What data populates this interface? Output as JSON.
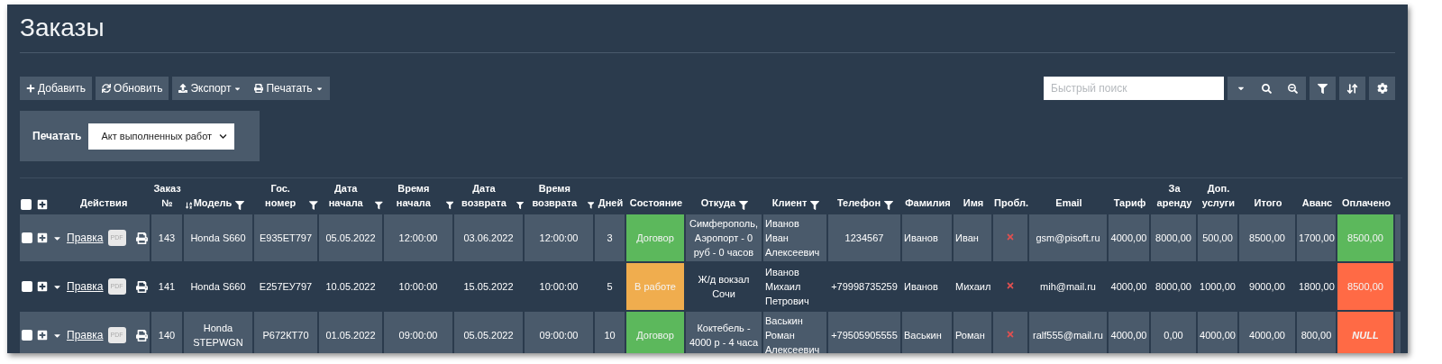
{
  "page": {
    "title": "Заказы"
  },
  "toolbar": {
    "buttons": [
      {
        "label": "Добавить",
        "kind": "add"
      },
      {
        "label": "Обновить",
        "kind": "refresh"
      }
    ],
    "menus": [
      {
        "label": "Экспорт",
        "kind": "export"
      },
      {
        "label": "Печатать",
        "kind": "print"
      }
    ]
  },
  "search": {
    "placeholder": "Быстрый поиск"
  },
  "print_panel": {
    "label": "Печатать",
    "value": "Акт выполненных работ"
  },
  "table": {
    "select_all_checked": false,
    "columns": [
      {
        "label": "Действия",
        "kind": "actions"
      },
      {
        "label": "Заказ №",
        "kind": "text"
      },
      {
        "label": "Модель",
        "kind": "text"
      },
      {
        "label": "Гос. номер",
        "kind": "text"
      },
      {
        "label": "Дата начала",
        "kind": "text"
      },
      {
        "label": "Время начала",
        "kind": "text"
      },
      {
        "label": "Дата возврата",
        "kind": "text"
      },
      {
        "label": "Время возврата",
        "kind": "text"
      },
      {
        "label": "Дней",
        "kind": "text"
      },
      {
        "label": "Состояние",
        "kind": "status"
      },
      {
        "label": "Откуда",
        "kind": "text"
      },
      {
        "label": "Клиент",
        "kind": "left"
      },
      {
        "label": "Телефон",
        "kind": "text"
      },
      {
        "label": "Фамилия",
        "kind": "left"
      },
      {
        "label": "Имя",
        "kind": "left"
      },
      {
        "label": "Пробл.",
        "kind": "problem"
      },
      {
        "label": "Email",
        "kind": "text"
      },
      {
        "label": "Тариф",
        "kind": "text"
      },
      {
        "label": "За аренду",
        "kind": "text"
      },
      {
        "label": "Доп. услуги",
        "kind": "text"
      },
      {
        "label": "Итого",
        "kind": "text"
      },
      {
        "label": "Аванс",
        "kind": "text"
      },
      {
        "label": "Оплачено",
        "kind": "paid"
      }
    ],
    "rows": [
      {
        "checked": false,
        "edit_label": "Правка",
        "pdf_label": "PDF",
        "cells": [
          null,
          "143",
          "Honda S660",
          "Е935ЕТ797",
          "05.05.2022",
          "12:00:00",
          "03.06.2022",
          "12:00:00",
          "3",
          {
            "text": "Договор",
            "color": "#5cb85c"
          },
          "Симферополь, Аэропорт - 0 руб - 0 часов",
          "Иванов Иван Алексеевич",
          "1234567",
          "Иванов",
          "Иван",
          {
            "problem": true
          },
          "gsm@pisoft.ru",
          "4000,00",
          "8000,00",
          "500,00",
          "8500,00",
          "1700,00",
          {
            "text": "8500,00",
            "color": "#5cb85c",
            "kind": "value"
          }
        ]
      },
      {
        "checked": false,
        "edit_label": "Правка",
        "pdf_label": "PDF",
        "cells": [
          null,
          "141",
          "Honda S660",
          "Е257ЕУ797",
          "10.05.2022",
          "10:00:00",
          "15.05.2022",
          "10:00:00",
          "5",
          {
            "text": "В работе",
            "color": "#f0ad4e"
          },
          "Ж/д вокзал Сочи",
          "Иванов Михаил Петрович",
          "+79998735259",
          "Иванов",
          "Михаил",
          {
            "problem": true
          },
          "mih@mail.ru",
          "4000,00",
          "8000,00",
          "1000,00",
          "9000,00",
          "1800,00",
          {
            "text": "8500,00",
            "color": "#ff6a45",
            "kind": "value"
          }
        ]
      },
      {
        "checked": false,
        "edit_label": "Правка",
        "pdf_label": "PDF",
        "cells": [
          null,
          "140",
          "Honda STEPWGN",
          "Р672КТ70",
          "01.05.2022",
          "09:00:00",
          "05.05.2022",
          "09:00:00",
          "10",
          {
            "text": "Договор",
            "color": "#5cb85c"
          },
          "Коктебель - 4000 р - 4 часа",
          "Васькин Роман Алексеевич",
          "+79505905555",
          "Васькин",
          "Роман",
          {
            "problem": true
          },
          "ralf555@mail.ru",
          "4000,00",
          "0,00",
          "4000,00",
          "4000,00",
          "800,00",
          {
            "text": "NULL",
            "color": "#ff6a45",
            "kind": "empty"
          }
        ]
      }
    ]
  }
}
